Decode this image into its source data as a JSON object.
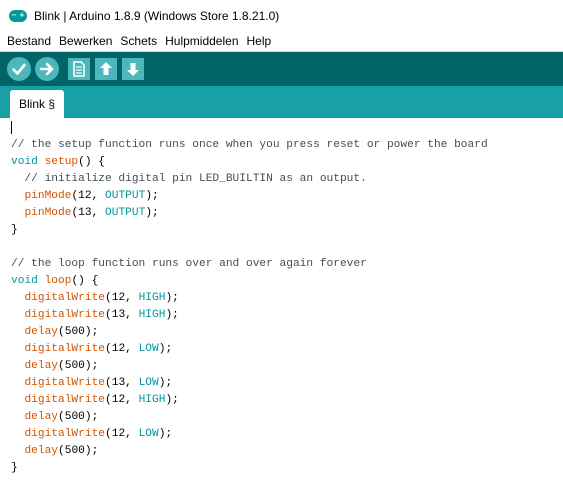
{
  "window": {
    "title": "Blink | Arduino 1.8.9 (Windows Store 1.8.21.0)",
    "icon": "arduino-infinity-icon",
    "icon_glyphs": [
      "−",
      "+"
    ]
  },
  "menu": {
    "items": [
      "Bestand",
      "Bewerken",
      "Schets",
      "Hulpmiddelen",
      "Help"
    ]
  },
  "toolbar": {
    "buttons": [
      "verify-icon",
      "upload-icon",
      "new-icon",
      "open-icon",
      "save-icon"
    ]
  },
  "tabs": [
    {
      "label": "Blink §"
    }
  ],
  "colors": {
    "toolbar_bg": "#006468",
    "tabbar_bg": "#17a1a5",
    "button_bg": "#4db7bb",
    "comment": "#434f54",
    "keyword": "#00979c",
    "function": "#d35400"
  },
  "code": {
    "lines": [
      [
        {
          "t": "// the setup function runs once when you press reset or power the board",
          "c": "c"
        }
      ],
      [
        {
          "t": "void",
          "c": "k"
        },
        {
          "t": " ",
          "c": "n"
        },
        {
          "t": "setup",
          "c": "f"
        },
        {
          "t": "() {",
          "c": "n"
        }
      ],
      [
        {
          "t": "  // initialize digital pin LED_BUILTIN as an output.",
          "c": "c"
        }
      ],
      [
        {
          "t": "  ",
          "c": "n"
        },
        {
          "t": "pinMode",
          "c": "f"
        },
        {
          "t": "(12, ",
          "c": "n"
        },
        {
          "t": "OUTPUT",
          "c": "k"
        },
        {
          "t": ");",
          "c": "n"
        }
      ],
      [
        {
          "t": "  ",
          "c": "n"
        },
        {
          "t": "pinMode",
          "c": "f"
        },
        {
          "t": "(13, ",
          "c": "n"
        },
        {
          "t": "OUTPUT",
          "c": "k"
        },
        {
          "t": ");",
          "c": "n"
        }
      ],
      [
        {
          "t": "}",
          "c": "n"
        }
      ],
      [
        {
          "t": "",
          "c": "n"
        }
      ],
      [
        {
          "t": "// the loop function runs over and over again forever",
          "c": "c"
        }
      ],
      [
        {
          "t": "void",
          "c": "k"
        },
        {
          "t": " ",
          "c": "n"
        },
        {
          "t": "loop",
          "c": "f"
        },
        {
          "t": "() {",
          "c": "n"
        }
      ],
      [
        {
          "t": "  ",
          "c": "n"
        },
        {
          "t": "digitalWrite",
          "c": "f"
        },
        {
          "t": "(12, ",
          "c": "n"
        },
        {
          "t": "HIGH",
          "c": "k"
        },
        {
          "t": ");",
          "c": "n"
        }
      ],
      [
        {
          "t": "  ",
          "c": "n"
        },
        {
          "t": "digitalWrite",
          "c": "f"
        },
        {
          "t": "(13, ",
          "c": "n"
        },
        {
          "t": "HIGH",
          "c": "k"
        },
        {
          "t": ");",
          "c": "n"
        }
      ],
      [
        {
          "t": "  ",
          "c": "n"
        },
        {
          "t": "delay",
          "c": "f"
        },
        {
          "t": "(500);",
          "c": "n"
        }
      ],
      [
        {
          "t": "  ",
          "c": "n"
        },
        {
          "t": "digitalWrite",
          "c": "f"
        },
        {
          "t": "(12, ",
          "c": "n"
        },
        {
          "t": "LOW",
          "c": "k"
        },
        {
          "t": ");",
          "c": "n"
        }
      ],
      [
        {
          "t": "  ",
          "c": "n"
        },
        {
          "t": "delay",
          "c": "f"
        },
        {
          "t": "(500);",
          "c": "n"
        }
      ],
      [
        {
          "t": "  ",
          "c": "n"
        },
        {
          "t": "digitalWrite",
          "c": "f"
        },
        {
          "t": "(13, ",
          "c": "n"
        },
        {
          "t": "LOW",
          "c": "k"
        },
        {
          "t": ");",
          "c": "n"
        }
      ],
      [
        {
          "t": "  ",
          "c": "n"
        },
        {
          "t": "digitalWrite",
          "c": "f"
        },
        {
          "t": "(12, ",
          "c": "n"
        },
        {
          "t": "HIGH",
          "c": "k"
        },
        {
          "t": ");",
          "c": "n"
        }
      ],
      [
        {
          "t": "  ",
          "c": "n"
        },
        {
          "t": "delay",
          "c": "f"
        },
        {
          "t": "(500);",
          "c": "n"
        }
      ],
      [
        {
          "t": "  ",
          "c": "n"
        },
        {
          "t": "digitalWrite",
          "c": "f"
        },
        {
          "t": "(12, ",
          "c": "n"
        },
        {
          "t": "LOW",
          "c": "k"
        },
        {
          "t": ");",
          "c": "n"
        }
      ],
      [
        {
          "t": "  ",
          "c": "n"
        },
        {
          "t": "delay",
          "c": "f"
        },
        {
          "t": "(500);",
          "c": "n"
        }
      ],
      [
        {
          "t": "}",
          "c": "n"
        }
      ]
    ]
  }
}
